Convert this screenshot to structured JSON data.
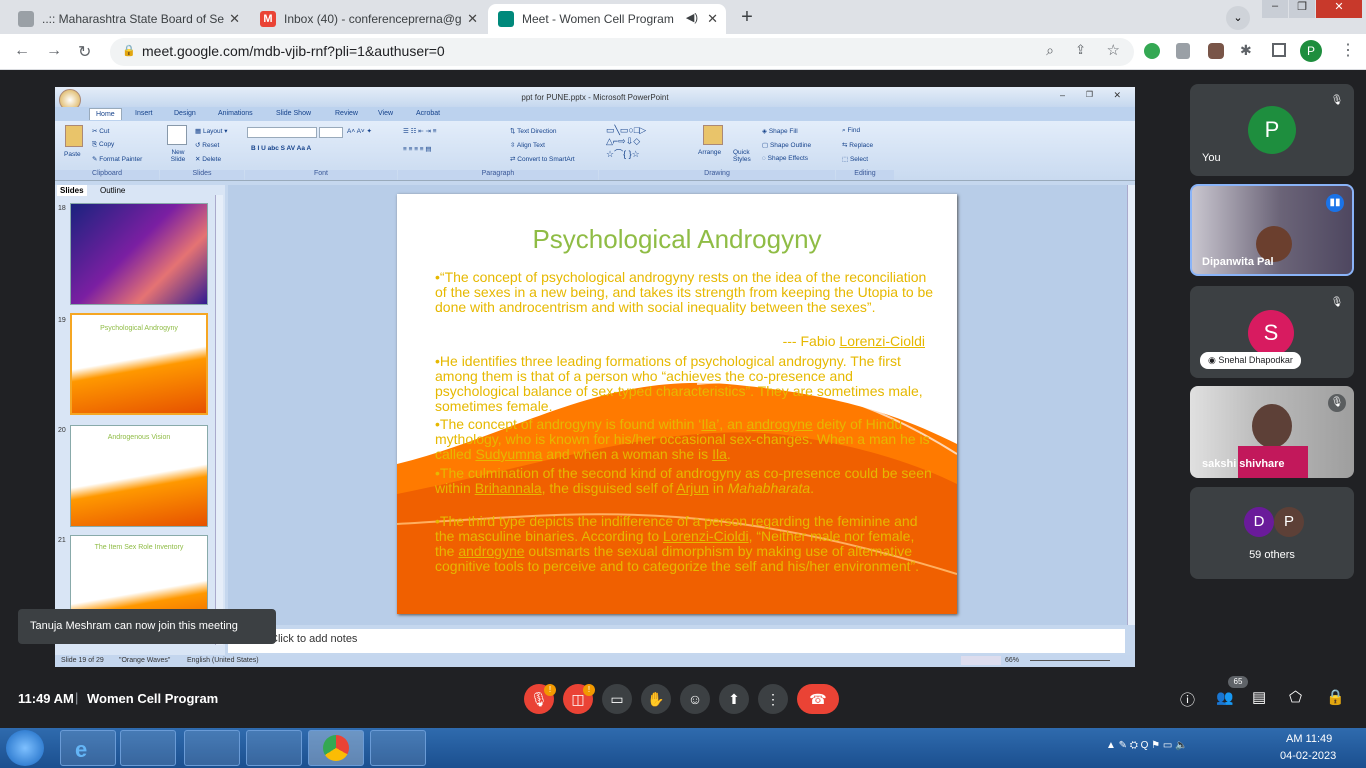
{
  "browser": {
    "tabs": [
      {
        "label": "..:: Maharashtra State Board of Se",
        "fav_color": "#5f6368"
      },
      {
        "label": "Inbox (40) - conferenceprerna@g",
        "fav_color": "#ea4335"
      },
      {
        "label": "Meet - Women Cell Program",
        "fav_color": "#00897b"
      }
    ],
    "url": "meet.google.com/mdb-vjib-rnf?pli=1&authuser=0",
    "profile_initial": "P"
  },
  "ppt": {
    "window_title": "ppt for PUNE.pptx - Microsoft PowerPoint",
    "ribbon_tabs": [
      "Home",
      "Insert",
      "Design",
      "Animations",
      "Slide Show",
      "Review",
      "View",
      "Acrobat"
    ],
    "clipboard": {
      "paste": "Paste",
      "cut": "Cut",
      "copy": "Copy",
      "format_painter": "Format Painter",
      "group": "Clipboard"
    },
    "slides_group": {
      "new_slide": "New Slide",
      "layout": "Layout",
      "reset": "Reset",
      "delete": "Delete",
      "group": "Slides"
    },
    "font_group": "Font",
    "paragraph": {
      "text_direction": "Text Direction",
      "align_text": "Align Text",
      "convert": "Convert to SmartArt",
      "group": "Paragraph"
    },
    "drawing": {
      "arrange": "Arrange",
      "quick_styles": "Quick Styles",
      "shape_fill": "Shape Fill",
      "shape_outline": "Shape Outline",
      "shape_effects": "Shape Effects",
      "group": "Drawing"
    },
    "editing": {
      "find": "Find",
      "replace": "Replace",
      "select": "Select",
      "group": "Editing"
    },
    "panel_tabs": [
      "Slides",
      "Outline"
    ],
    "thumbs": [
      {
        "num": "18",
        "title": ""
      },
      {
        "num": "19",
        "title": "Psychological Androgyny"
      },
      {
        "num": "20",
        "title": "Androgenous Vision"
      },
      {
        "num": "21",
        "title": "The Item Sex Role Inventory"
      }
    ],
    "slide": {
      "title": "Psychological Androgyny",
      "p1": "•“The concept of psychological androgyny rests on the idea of the reconciliation of the sexes in a new being, and takes its strength from keeping the Utopia to be done with androcentrism and with social inequality between the sexes”.",
      "p1_attrib_prefix": "--- Fabio ",
      "p1_attrib_name": "Lorenzi-Cioldi",
      "p2": "•He identifies three leading formations of psychological androgyny. The first among them is that of a person who “achieves the co-presence and psychological balance of sex-typed characteristics”. They are sometimes male, sometimes female.",
      "p3a": "•The concept of androgyny is found within ‘",
      "p3_ila": "Ila",
      "p3b": "’, an ",
      "p3_androgyne": "androgyne",
      "p3c": " deity of Hindu mythology, who is known for his/her occasional sex-changes. When a man he is called ",
      "p3_sudyumna": "Sudyumna",
      "p3d": " and when a woman she is ",
      "p3_ila2": "Ila",
      "p3e": ".",
      "p4a": "•The culmination of the second kind of androgyny as co-presence could be seen within ",
      "p4_brihannala": "Brihannala",
      "p4b": ", the disguised self of ",
      "p4_arjun": "Arjun",
      "p4c": " in ",
      "p4_maha": "Mahabharata",
      "p4d": ".",
      "p5a": "•The third type depicts the indifference of a person regarding the feminine and the masculine binaries. According to ",
      "p5_lc": "Lorenzi-Cioldi",
      "p5b": ", “Neither male nor female, the ",
      "p5_androgyne": "androgyne",
      "p5c": " outsmarts the sexual dimorphism by making use of alternative cognitive tools to perceive and to categorize the self and his/her environment”."
    },
    "notes_placeholder": "Click to add notes",
    "status": {
      "slide": "Slide 19 of 29",
      "theme": "\"Orange Waves\"",
      "lang": "English (United States)",
      "zoom": "66%"
    }
  },
  "meet": {
    "participants": [
      {
        "name": "You",
        "initial": "P",
        "color": "#1e8e3e"
      },
      {
        "name": "Dipanwita Pal"
      },
      {
        "name": "Snehal Dhapodkar",
        "initial": "S",
        "color": "#d81b60"
      },
      {
        "name": "sakshi shivhare"
      },
      {
        "name": "59 others",
        "initials": [
          "D",
          "P"
        ],
        "colors": [
          "#6a1b9a",
          "#5d4037"
        ]
      }
    ],
    "toast": "Tanuja Meshram can now join this meeting",
    "time": "11:49 AM",
    "separator": "|",
    "meeting_name": "Women Cell Program",
    "people_count": "65",
    "badge": "!"
  },
  "taskbar": {
    "time": "AM 11:49",
    "date": "04-02-2023"
  }
}
